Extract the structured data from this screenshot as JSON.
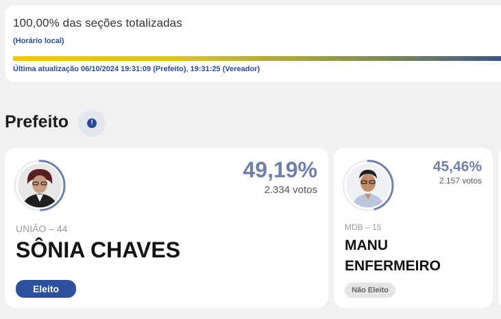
{
  "progress": {
    "title": "100,00% das seções totalizadas",
    "subtitle": "(Horário local)",
    "fill_fraction": 1.0,
    "updated": "Última atualização 06/10/2024 19:31:09 (Prefeito), 19:31:25 (Vereador)"
  },
  "section": {
    "title": "Prefeito",
    "info_icon": "!"
  },
  "candidates": [
    {
      "percent": "49,19%",
      "percent_value": 49.19,
      "votes": "2.334 votos",
      "party": "UNIÃO – 44",
      "name": "SÔNIA CHAVES",
      "status": "Eleito"
    },
    {
      "percent": "45,46%",
      "percent_value": 45.46,
      "votes": "2.157 votos",
      "party": "MDB – 15",
      "name_line1": "MANU",
      "name_line2": "ENFERMEIRO",
      "status": "Não Eleito"
    }
  ],
  "colors": {
    "accent": "#2e4f9c",
    "percent_text": "#6f7fa6",
    "progress_start": "#f2c80c",
    "progress_end": "#38508a"
  }
}
